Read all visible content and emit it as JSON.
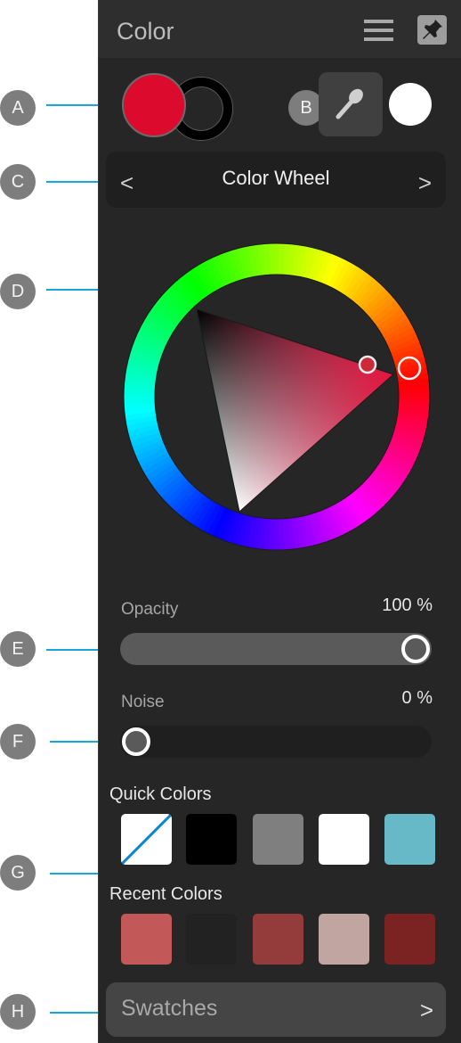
{
  "callouts": [
    {
      "letter": "A",
      "target": "primary-secondary-colors"
    },
    {
      "letter": "B",
      "target": "eyedropper"
    },
    {
      "letter": "C",
      "target": "mode-selector"
    },
    {
      "letter": "D",
      "target": "color-wheel"
    },
    {
      "letter": "E",
      "target": "opacity-slider"
    },
    {
      "letter": "F",
      "target": "noise-slider"
    },
    {
      "letter": "G",
      "target": "quick-recent-colors"
    },
    {
      "letter": "H",
      "target": "swatches"
    }
  ],
  "header": {
    "title": "Color",
    "menu_icon": "hamburger-menu-icon",
    "pin_icon": "pushpin-icon"
  },
  "colors": {
    "primary_fill": "#dc0a2d",
    "secondary_stroke": "#000000",
    "eyedropper_icon": "eyedropper-icon",
    "picked_color": "#ffffff",
    "accent_leader": "#1aa6d9"
  },
  "mode_selector": {
    "label": "Color Wheel",
    "prev_label": "<",
    "next_label": ">"
  },
  "wheel": {
    "hue_degrees": 350,
    "selected_color": "#cc2a3a"
  },
  "opacity": {
    "label": "Opacity",
    "value_text": "100 %",
    "value": 1.0
  },
  "noise": {
    "label": "Noise",
    "value_text": "0 %",
    "value": 0.0
  },
  "quick_colors": {
    "label": "Quick Colors",
    "items": [
      {
        "name": "none",
        "color": "#ffffff",
        "is_none": true
      },
      {
        "name": "black",
        "color": "#000000"
      },
      {
        "name": "gray",
        "color": "#7f7f7f"
      },
      {
        "name": "white",
        "color": "#ffffff"
      },
      {
        "name": "teal",
        "color": "#67b9c8"
      }
    ]
  },
  "recent_colors": {
    "label": "Recent Colors",
    "items": [
      {
        "color": "#c25858"
      },
      {
        "color": "#222222"
      },
      {
        "color": "#943c3c"
      },
      {
        "color": "#c0a5a1"
      },
      {
        "color": "#7b2223"
      }
    ]
  },
  "swatches": {
    "label": "Swatches",
    "chevron": ">"
  }
}
